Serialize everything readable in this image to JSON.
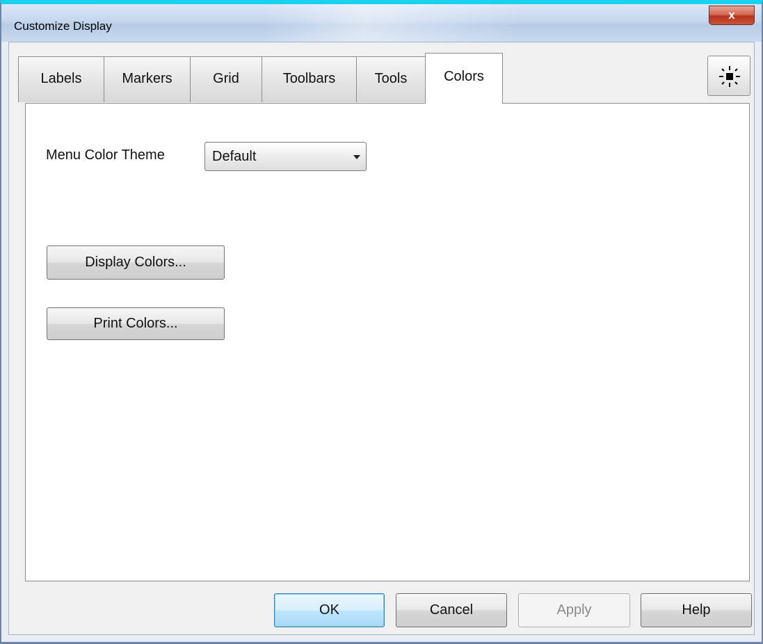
{
  "window": {
    "title": "Customize Display",
    "close_label": "x"
  },
  "tabs": [
    {
      "label": "Labels",
      "active": false
    },
    {
      "label": "Markers",
      "active": false
    },
    {
      "label": "Grid",
      "active": false
    },
    {
      "label": "Toolbars",
      "active": false
    },
    {
      "label": "Tools",
      "active": false
    },
    {
      "label": "Colors",
      "active": true
    }
  ],
  "colors_tab": {
    "menu_theme_label": "Menu Color Theme",
    "menu_theme_value": "Default",
    "display_colors_label": "Display Colors...",
    "print_colors_label": "Print Colors..."
  },
  "footer": {
    "ok_label": "OK",
    "cancel_label": "Cancel",
    "apply_label": "Apply",
    "help_label": "Help"
  },
  "icons": {
    "close": "close-icon",
    "sun": "sun-icon",
    "dropdown": "chevron-down-icon"
  },
  "colors": {
    "title_accent": "#19d2f0",
    "close_button": "#c6543a",
    "default_button": "#bee6fd"
  }
}
